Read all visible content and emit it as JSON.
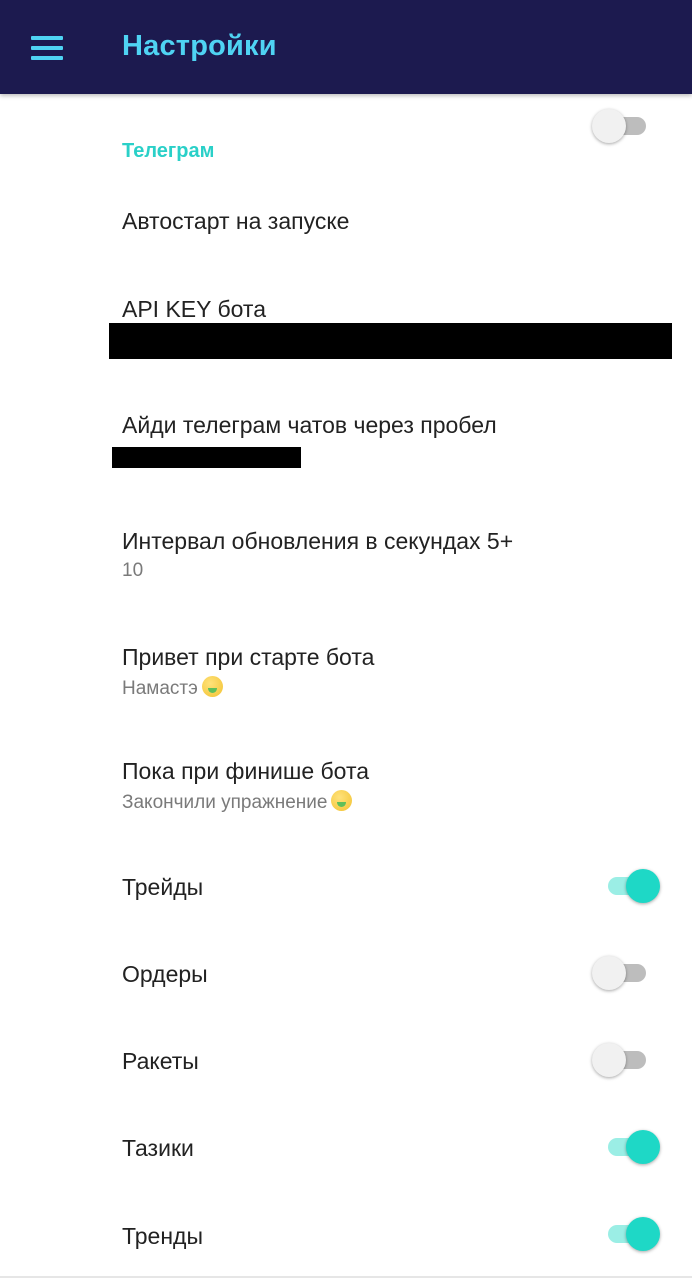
{
  "app_bar": {
    "title": "Настройки",
    "menu_icon": "hamburger-menu-icon",
    "background_color": "#1c1a4f",
    "accent_color": "#4fd3f3"
  },
  "section": {
    "header": "Телеграм",
    "header_color": "#2ad0c8"
  },
  "settings": {
    "autostart": {
      "title": "Автостарт на запуске",
      "enabled": false
    },
    "api_key": {
      "title": "API KEY бота",
      "value_redacted": true
    },
    "chat_ids": {
      "title": "Айди телеграм чатов через пробел",
      "value_redacted": true
    },
    "interval": {
      "title": "Интервал обновления в секундах 5+",
      "value": "10"
    },
    "greeting": {
      "title": "Привет при старте бота",
      "value": "Намастэ",
      "emoji_icon": "money-mouth-face-icon"
    },
    "farewell": {
      "title": "Пока при финише бота",
      "value": "Закончили упражнение",
      "emoji_icon": "money-mouth-face-icon"
    },
    "trades": {
      "title": "Трейды",
      "enabled": true
    },
    "orders": {
      "title": "Ордеры",
      "enabled": false
    },
    "rockets": {
      "title": "Ракеты",
      "enabled": false
    },
    "basins": {
      "title": "Тазики",
      "enabled": true
    },
    "trends": {
      "title": "Тренды",
      "enabled": true
    }
  },
  "colors": {
    "switch_on_thumb": "#1ed8c6",
    "switch_on_track": "#9beee5",
    "switch_off_thumb": "#f1f1f1",
    "switch_off_track": "#bdbdbd"
  }
}
